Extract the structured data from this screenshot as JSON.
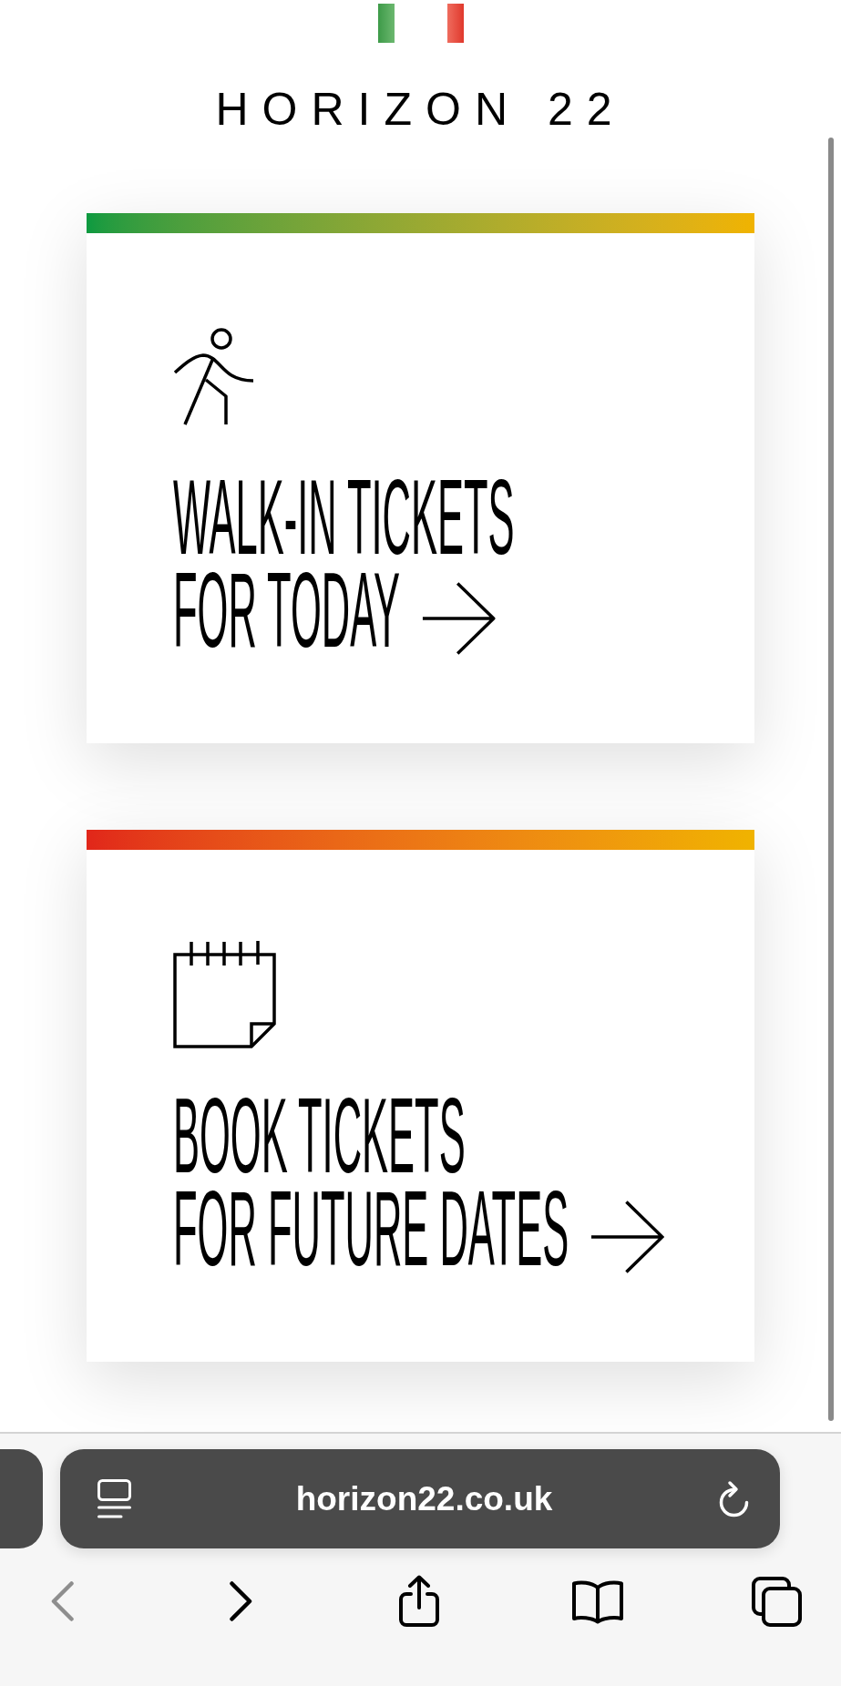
{
  "header": {
    "title": "HORIZON 22"
  },
  "cards": [
    {
      "kind": "walkin",
      "title_lines": [
        "WALK-IN TICKETS",
        "FOR TODAY"
      ]
    },
    {
      "kind": "booking",
      "title_lines": [
        "BOOK TICKETS",
        "FOR FUTURE DATES"
      ]
    }
  ],
  "browser": {
    "url": "horizon22.co.uk",
    "back": {
      "disabled": true
    },
    "forward": {
      "disabled": false
    }
  }
}
